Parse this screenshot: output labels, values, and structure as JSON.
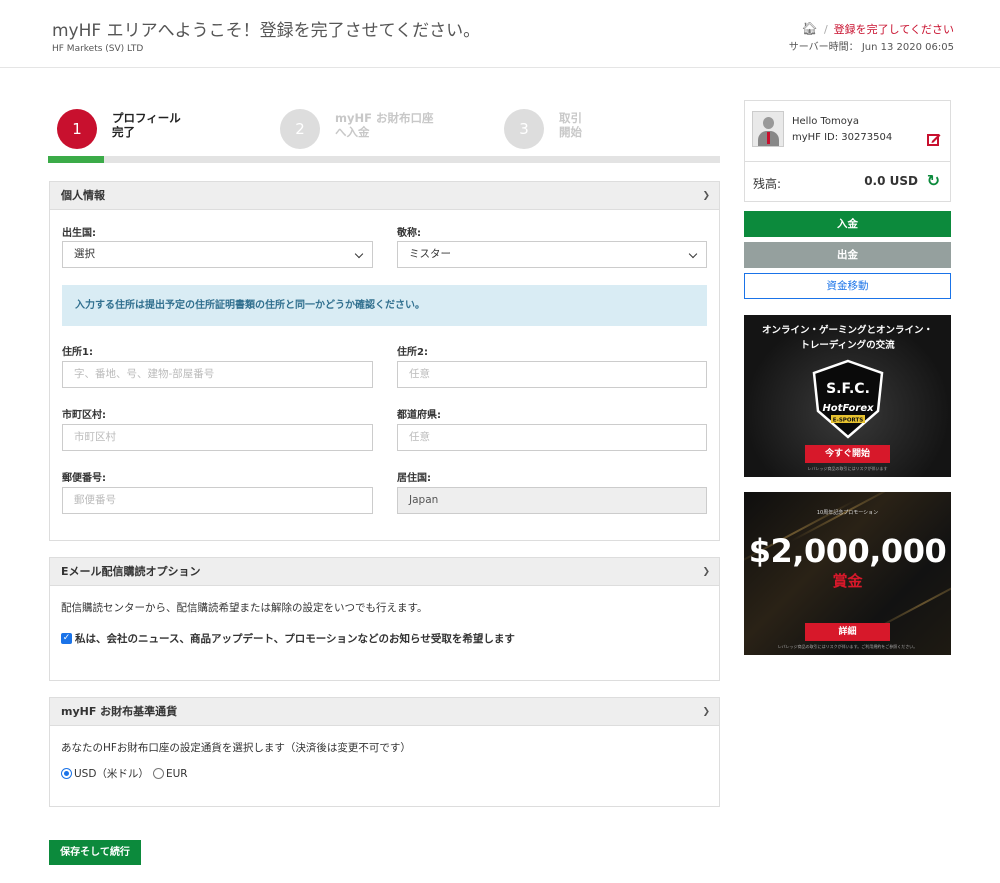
{
  "header": {
    "title": "myHF エリアへようこそ！登録を完了させてください。",
    "company": "HF Markets (SV) LTD",
    "breadcrumb_home_icon": "home-icon",
    "breadcrumb_sep": "/",
    "breadcrumb_active": "登録を完了してください",
    "server_time": "サーバー時間： Jun 13 2020 06:05"
  },
  "steps": [
    {
      "number": "1",
      "label": "プロフィール\n完了",
      "state": "active"
    },
    {
      "number": "2",
      "label": "myHF お財布口座\nへ入金",
      "state": "inactive"
    },
    {
      "number": "3",
      "label": "取引\n開始",
      "state": "inactive"
    }
  ],
  "progress_fraction": 0.083,
  "personal": {
    "header": "個人情報",
    "birth_country_label": "出生国:",
    "birth_country_value": "選択",
    "title_label": "敬称:",
    "title_value": "ミスター",
    "info": "入力する住所は提出予定の住所証明書類の住所と同一かどうか確認ください。",
    "address1_label": "住所1:",
    "address1_placeholder": "字、番地、号、建物-部屋番号",
    "address2_label": "住所2:",
    "address2_placeholder": "任意",
    "city_label": "市町区村:",
    "city_placeholder": "市町区村",
    "prefecture_label": "都道府県:",
    "prefecture_placeholder": "任意",
    "zip_label": "郵便番号:",
    "zip_placeholder": "郵便番号",
    "residence_label": "居住国:",
    "residence_value": "Japan"
  },
  "email": {
    "header": "Eメール配信購読オプション",
    "desc": "配信購読センターから、配信購読希望または解除の設定をいつでも行えます。",
    "checkbox_label": "私は、会社のニュース、商品アップデート、プロモーションなどのお知らせ受取を希望します",
    "checked": true
  },
  "currency": {
    "header": "myHF お財布基準通貨",
    "desc": "あなたのHFお財布口座の設定通貨を選択します（決済後は変更不可です）",
    "option_usd": "USD（米ドル）",
    "option_eur": "EUR",
    "selected": "USD"
  },
  "save_button": "保存そして続行",
  "user": {
    "hello": "Hello  Tomoya",
    "myhf_id": "myHF ID: 30273504",
    "balance_label": "残高:",
    "balance_value": "0.0 USD"
  },
  "actions": {
    "deposit": "入金",
    "withdraw": "出金",
    "transfer": "資金移動"
  },
  "banner1": {
    "text": "オンライン・ゲーミングとオンライン・\nトレーディングの交流",
    "logo_top": "S.F.C.",
    "logo_brand": "HotForex",
    "logo_sub": "E-SPORTS",
    "cta": "今すぐ開始",
    "fine": "レバレッジ商品の取引にはリスクが伴います"
  },
  "banner2": {
    "promo": "10周年記念プロモーション",
    "amount": "$2,000,000",
    "prize": "賞金",
    "cta": "詳細",
    "fine": "レバレッジ商品の取引にはリスクが伴います。ご利用規約をご参照ください。"
  },
  "colors": {
    "brand_red": "#c8102e",
    "green": "#0c8a3c",
    "grey_button": "#95a09e",
    "link_blue": "#1a73e8",
    "info_bg": "#d9ecf4"
  }
}
